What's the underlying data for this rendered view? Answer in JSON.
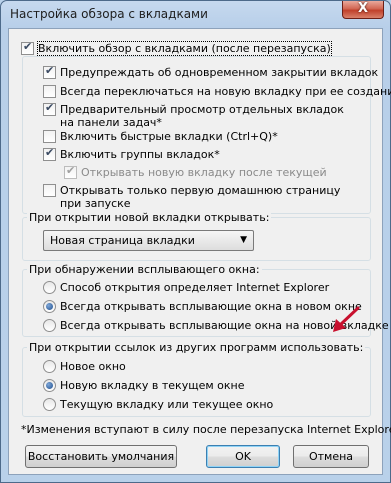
{
  "window": {
    "title": "Настройка обзора с вкладками",
    "close_glyph": "X"
  },
  "options": {
    "enable_tabs": "Включить обзор с вкладками (после перезапуска)",
    "warn_close": "Предупреждать об одновременном закрытии вкладок",
    "switch_new": "Всегда переключаться на новую вкладку при ее создании",
    "preview": "Предварительный просмотр отдельных вкладок на панели задач*",
    "quick_tabs": "Включить быстрые вкладки (Ctrl+Q)*",
    "tab_groups": "Включить группы вкладок*",
    "open_after_current": "Открывать новую вкладку после текущей",
    "first_home": "Открывать только первую домашнюю страницу при запуске"
  },
  "new_tab_group": {
    "title": "При открытии новой вкладки открывать:",
    "selected": "Новая страница вкладки",
    "arrow": "▼"
  },
  "popup_group": {
    "title": "При обнаружении всплывающего окна:",
    "opt1": "Способ открытия определяет Internet Explorer",
    "opt2": "Всегда открывать всплывающие окна в новом окне",
    "opt3": "Всегда открывать всплывающие окна на новой вкладке"
  },
  "links_group": {
    "title": "При открытии ссылок из других программ использовать:",
    "opt1": "Новое окно",
    "opt2": "Новую вкладку в текущем окне",
    "opt3": "Текущую вкладку или текущее окно"
  },
  "footnote": "*Изменения вступают в силу после перезапуска Internet Explorer",
  "buttons": {
    "restore": "Восстановить умолчания",
    "ok": "OK",
    "cancel": "Отмена"
  },
  "colors": {
    "annotation_arrow": "#c8102e"
  }
}
